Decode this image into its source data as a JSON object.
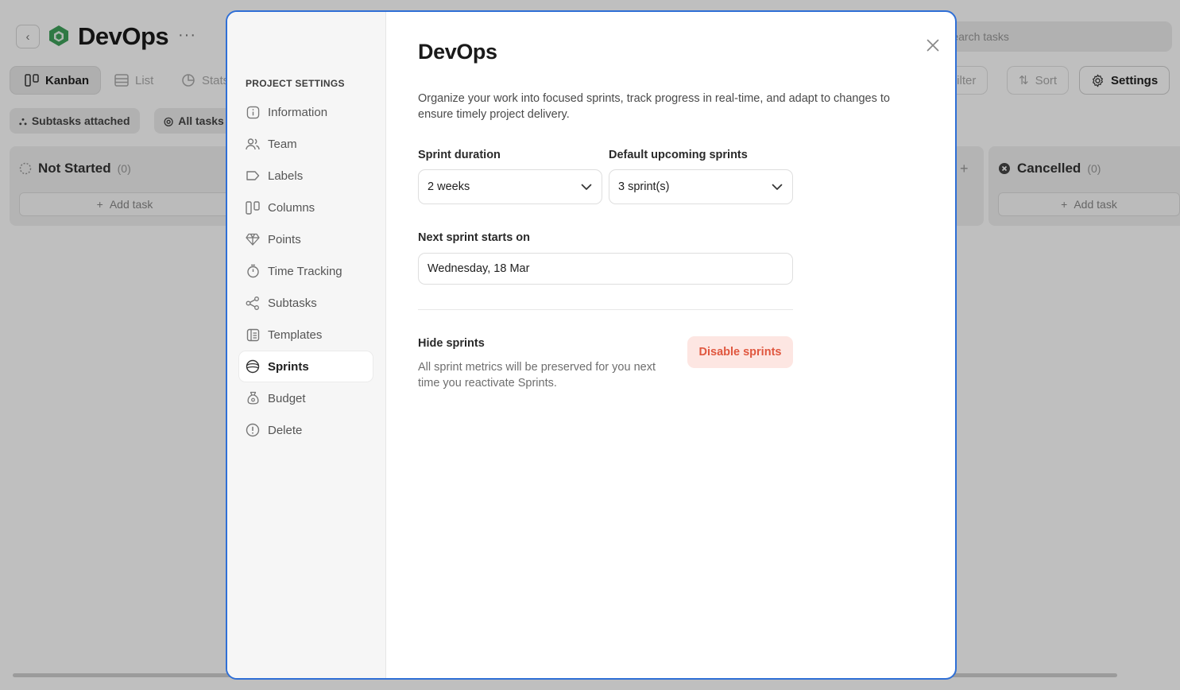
{
  "app": {
    "title": "DevOps",
    "more": "···",
    "search_placeholder": "Search tasks",
    "views": [
      {
        "label": "Kanban",
        "icon": "kanban-icon"
      },
      {
        "label": "List",
        "icon": "list-icon"
      },
      {
        "label": "Stats",
        "icon": "stats-icon"
      }
    ],
    "toolbar": {
      "filter": "Filter",
      "sort": "Sort",
      "settings": "Settings"
    },
    "chips": {
      "subtasks": "Subtasks attached",
      "all_tasks": "All tasks"
    },
    "columns": [
      {
        "name": "Not Started",
        "count": "(0)",
        "add": "Add task"
      },
      {
        "name": "Cancelled",
        "count": "(0)",
        "add": "Add task"
      }
    ]
  },
  "modal": {
    "sidebar_heading": "PROJECT SETTINGS",
    "nav": [
      {
        "label": "Information",
        "icon": "info-icon"
      },
      {
        "label": "Team",
        "icon": "team-icon"
      },
      {
        "label": "Labels",
        "icon": "label-icon"
      },
      {
        "label": "Columns",
        "icon": "columns-icon"
      },
      {
        "label": "Points",
        "icon": "diamond-icon"
      },
      {
        "label": "Time Tracking",
        "icon": "timer-icon"
      },
      {
        "label": "Subtasks",
        "icon": "subtasks-icon"
      },
      {
        "label": "Templates",
        "icon": "templates-icon"
      },
      {
        "label": "Sprints",
        "icon": "sprints-icon",
        "active": true
      },
      {
        "label": "Budget",
        "icon": "budget-icon"
      },
      {
        "label": "Delete",
        "icon": "delete-icon"
      }
    ],
    "title": "DevOps",
    "description": "Organize your work into focused sprints, track progress in real-time, and adapt to changes to ensure timely project delivery.",
    "sprint_duration": {
      "label": "Sprint duration",
      "value": "2 weeks"
    },
    "upcoming_sprints": {
      "label": "Default upcoming sprints",
      "value": "3 sprint(s)"
    },
    "next_sprint": {
      "label": "Next sprint starts on",
      "value": "Wednesday, 18 Mar"
    },
    "hide": {
      "title": "Hide sprints",
      "description": "All sprint metrics will be preserved for you next time you reactivate Sprints.",
      "button": "Disable sprints"
    }
  },
  "colors": {
    "accent_border": "#2f6fd6",
    "danger_bg": "#fde6e2",
    "danger_text": "#e0573f",
    "logo_green": "#3fa25b"
  }
}
